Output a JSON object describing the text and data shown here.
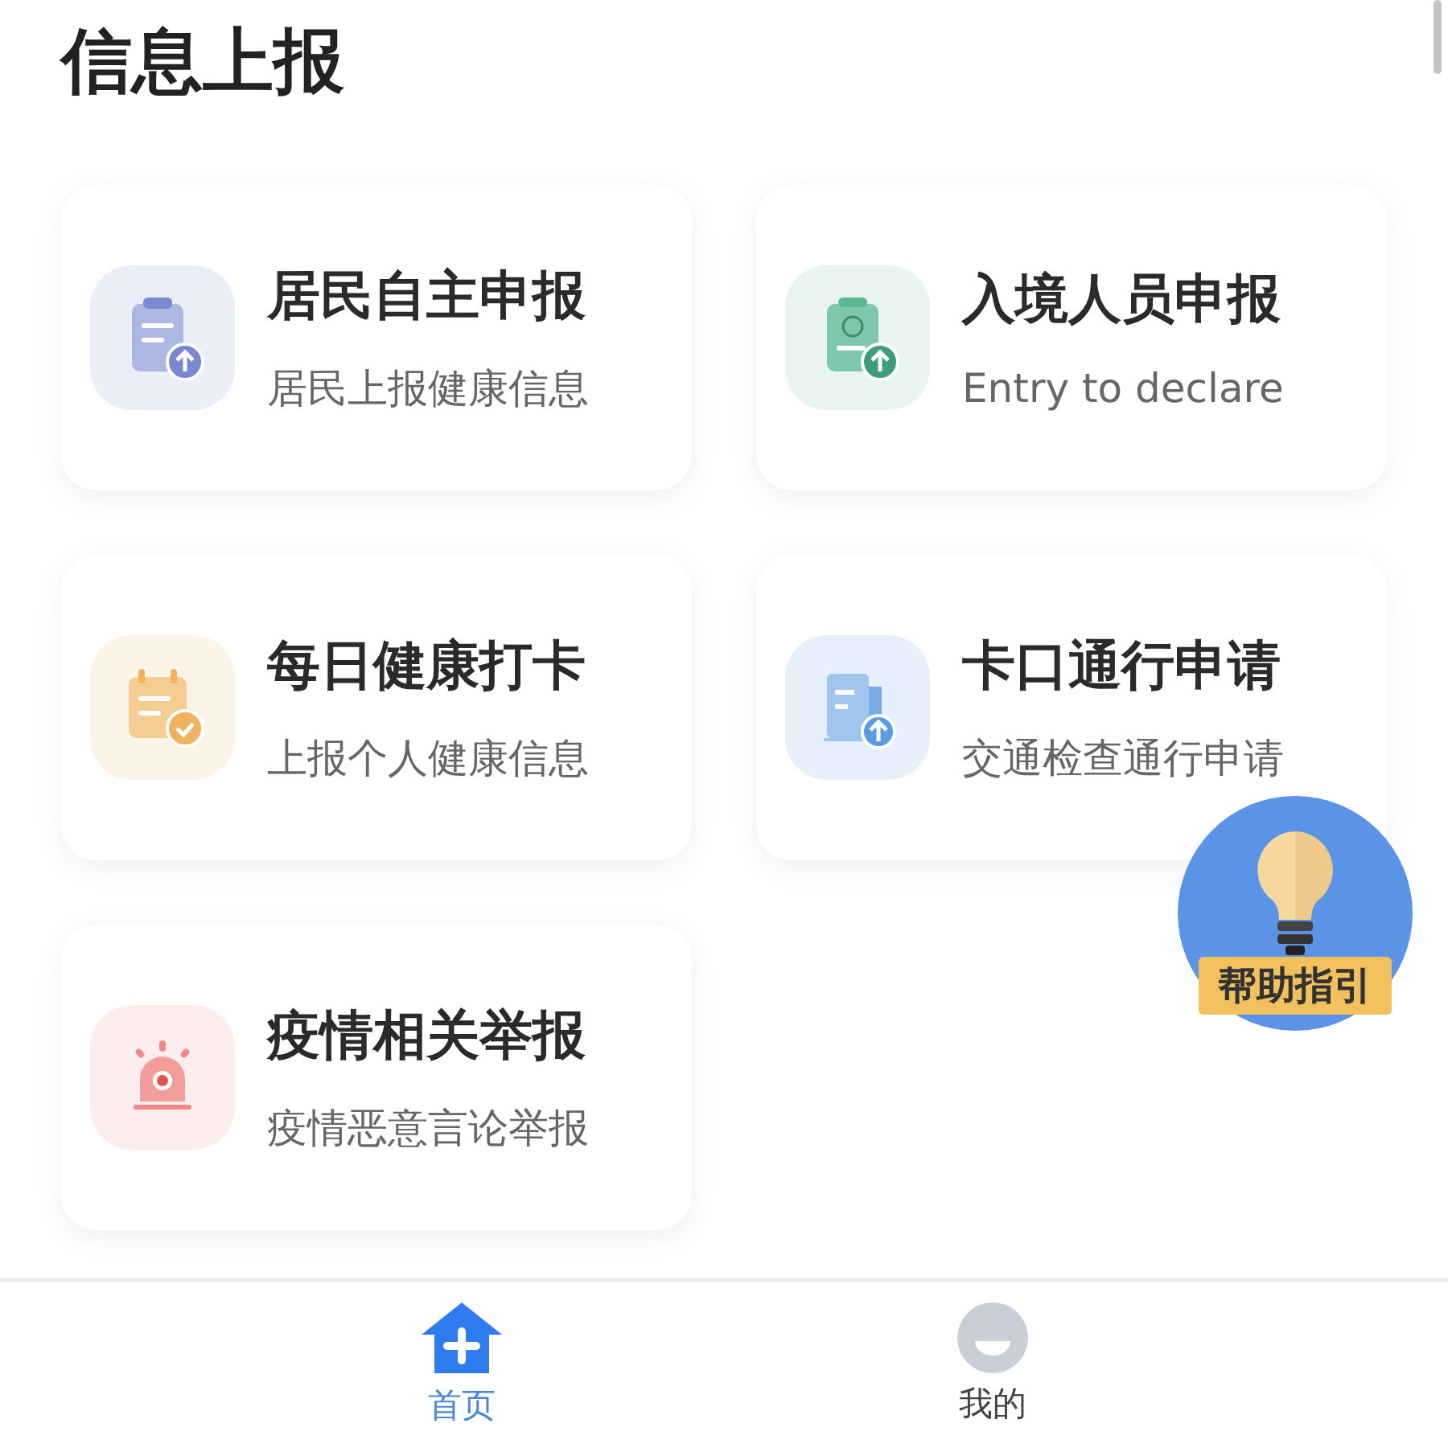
{
  "page_title": "信息上报",
  "cards": [
    {
      "kind": "clipboard",
      "color": "#7b88d0",
      "title": "居民自主申报",
      "subtitle": "居民上报健康信息"
    },
    {
      "kind": "passport",
      "color": "#5cb895",
      "title": "入境人员申报",
      "subtitle": "Entry to declare"
    },
    {
      "kind": "calendar",
      "color": "#f0b25c",
      "title": "每日健康打卡",
      "subtitle": "上报个人健康信息"
    },
    {
      "kind": "document",
      "color": "#5b9be0",
      "title": "卡口通行申请",
      "subtitle": "交通检查通行申请"
    },
    {
      "kind": "alarm",
      "color": "#ee8a85",
      "title": "疫情相关举报",
      "subtitle": "疫情恶意言论举报"
    }
  ],
  "help_button": {
    "label": "帮助指引"
  },
  "tab_bar": [
    {
      "kind": "home",
      "label": "首页",
      "selected": true
    },
    {
      "kind": "profile",
      "label": "我的",
      "selected": false
    }
  ]
}
